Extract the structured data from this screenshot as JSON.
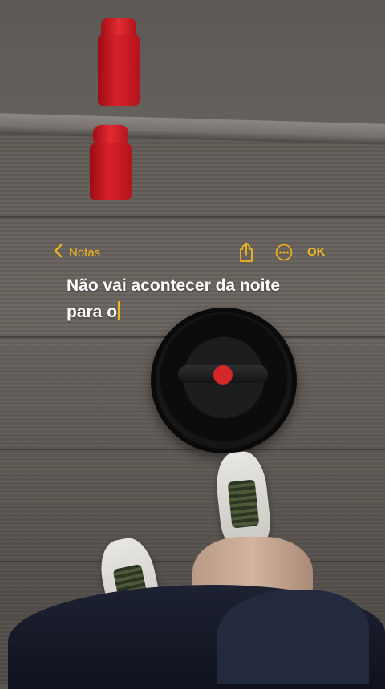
{
  "notes": {
    "back_label": "Notas",
    "done_label": "OK",
    "text_line1": "Não vai acontecer da noite",
    "text_line2": "para o"
  },
  "colors": {
    "accent": "#f2b51e",
    "text": "#ffffff"
  },
  "icons": {
    "back": "chevron-left-icon",
    "share": "share-icon",
    "more": "ellipsis-circle-icon"
  }
}
